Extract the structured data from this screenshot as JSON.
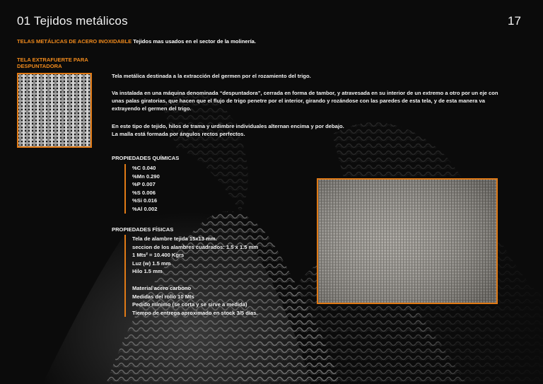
{
  "header": {
    "title": "01 Tejidos metálicos",
    "page_number": "17"
  },
  "subtitle": {
    "accent": "TELAS METÁLICAS DE ACERO INOXIDABLE",
    "rest": "Tejidos mas usados en el sector de la molinería."
  },
  "section_label": "TELA EXTRAFUERTE PARA DESPUNTADORA",
  "paragraphs": [
    "Tela metálica destinada a la extracción del germen por el rozamiento del trigo.",
    "Va instalada en una máquina denominada “despuntadora”, cerrada en forma de tambor, y atravesada en su interior de un extremo a otro por un eje con unas palas giratorias, que hacen que el flujo de trigo penetre por el interior, girando y rozándose con las paredes de esta tela, y de esta manera va extrayendo el germen del trigo.",
    "En este tipo de tejido, hilos de trama y urdimbre individuales alternan encima y por debajo.",
    "La malla está formada por ángulos rectos perfectos."
  ],
  "chemical": {
    "heading": "PROPIEDADES QUÍMICAS",
    "items": [
      "%C 0.040",
      "%Mn 0.290",
      "%P 0.007",
      "%S 0.006",
      "%Si 0.016",
      "%Al 0.002"
    ]
  },
  "physical": {
    "heading": "PROPIEDADES FÍSICAS",
    "items": [
      "Tela de alambre tejida 15x13 mm.",
      "seccion de los alambres cuadrados: 1.5 x 1.5 mm",
      "1 Mts² = 10.400 Kgrs",
      "Luz (w) 1.5 mm",
      "Hilo 1.5 mm"
    ],
    "extra": [
      "Material acero carbono",
      "Medidas del rollo 10 Mts",
      "Pedido mínimo (se corta y se sirve a medida)",
      "Tiempo de entrega aproximado en stock 3/5 días."
    ]
  },
  "colors": {
    "accent": "#f08a1c",
    "background": "#0b0b0b",
    "text": "#f4f4f4"
  }
}
